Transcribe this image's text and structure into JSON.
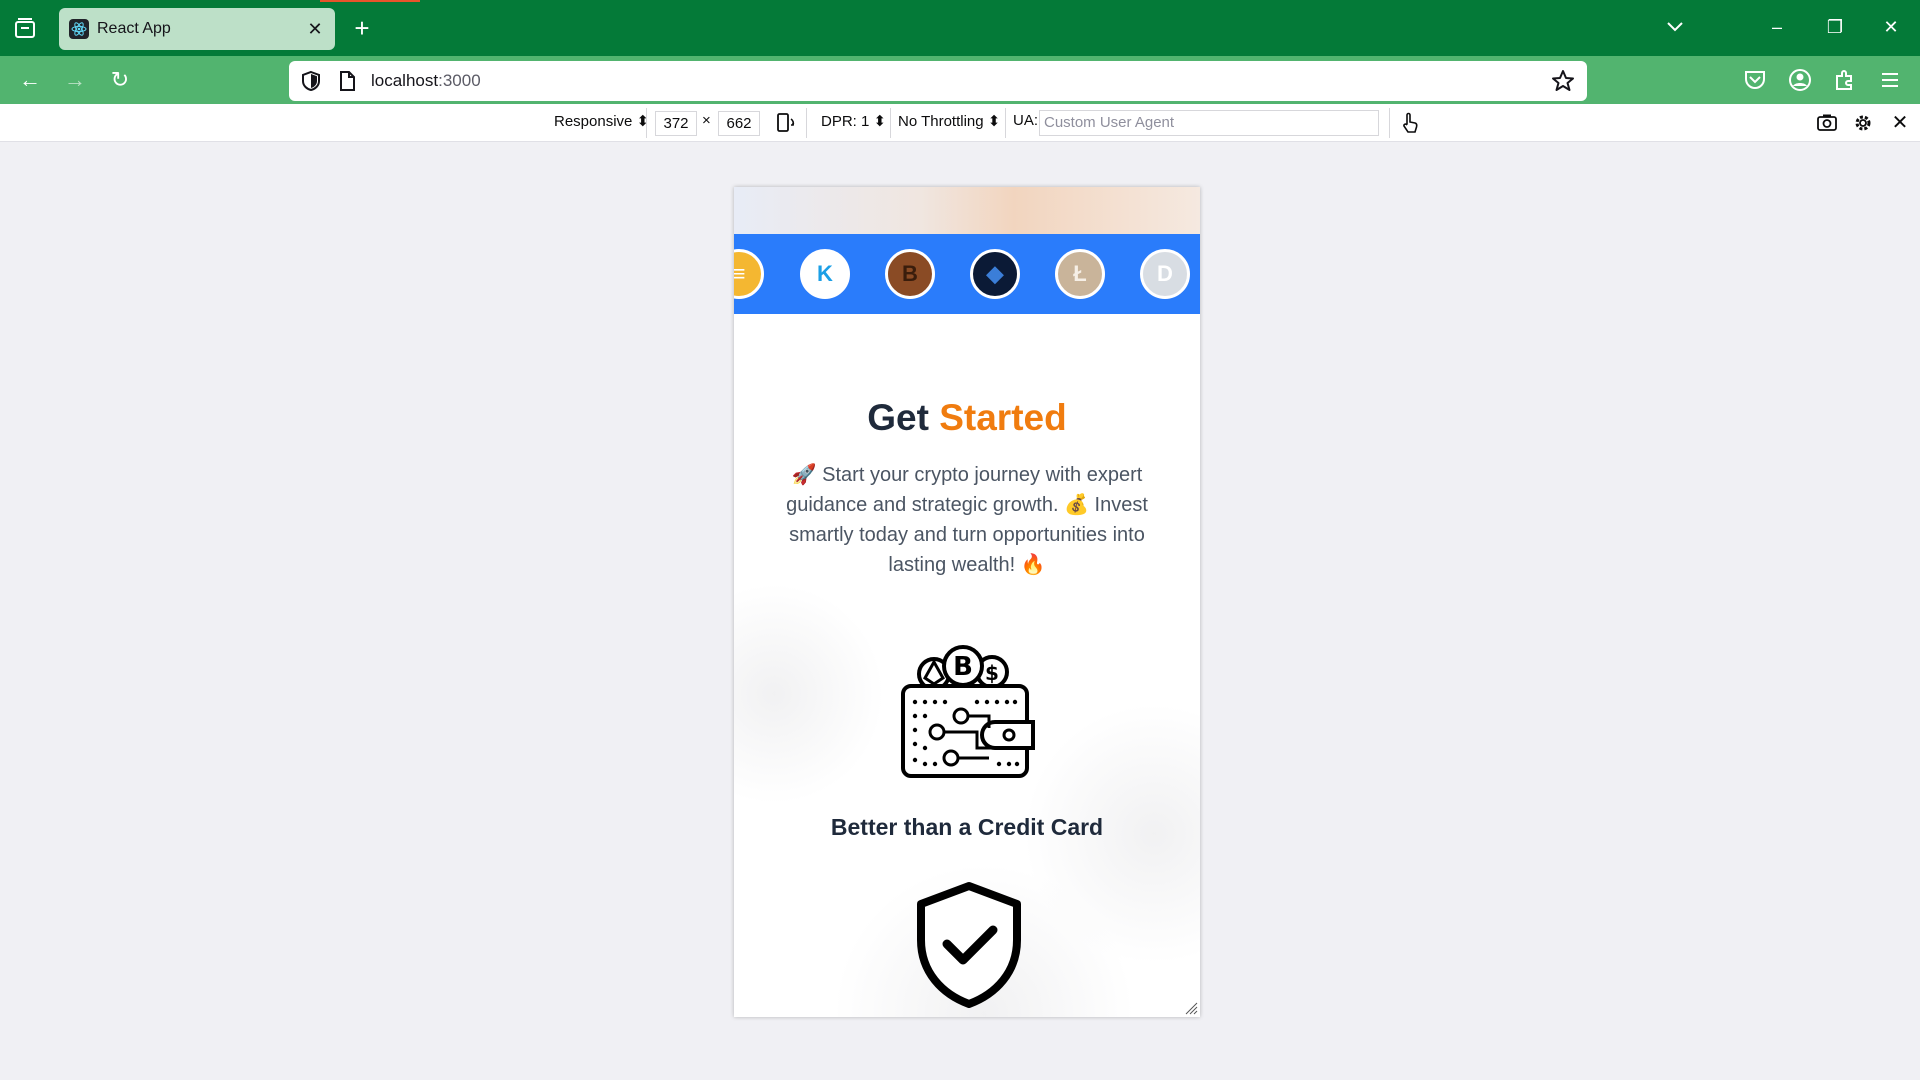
{
  "browser": {
    "tab": {
      "title": "React App"
    },
    "url": {
      "host": "localhost",
      "port": ":3000"
    }
  },
  "rdm": {
    "device": "Responsive",
    "width": "372",
    "times": "×",
    "height": "662",
    "dpr": "DPR: 1",
    "throttling": "No Throttling",
    "ua_label": "UA:",
    "ua_placeholder": "Custom User Agent"
  },
  "page": {
    "heading": {
      "main": "Get",
      "accent": "Started"
    },
    "description": "🚀 Start your crypto journey with expert guidance and strategic growth. 💰 Invest smartly today and turn opportunities into lasting wealth! 🔥",
    "features": [
      {
        "title": "Better than a Credit Card",
        "icon": "crypto-wallet-icon"
      },
      {
        "icon": "shield-check-icon"
      }
    ],
    "coins": [
      {
        "name": "dai-coin",
        "color": "#f4b731",
        "glyph": "≡"
      },
      {
        "name": "kucoin-coin",
        "color": "#ffffff",
        "glyph": "K"
      },
      {
        "name": "bitcoin-coin",
        "color": "#8a4b25",
        "glyph": "B"
      },
      {
        "name": "ethereum-coin",
        "color": "#0b1a36",
        "glyph": "◆"
      },
      {
        "name": "litecoin-coin",
        "color": "#c9b49a",
        "glyph": "Ł"
      },
      {
        "name": "dash-coin",
        "color": "#d8dde3",
        "glyph": "D"
      }
    ]
  },
  "colors": {
    "accent": "#f07c0f",
    "coin_bar": "#2a7cfb",
    "heading": "#1f2a3b"
  }
}
